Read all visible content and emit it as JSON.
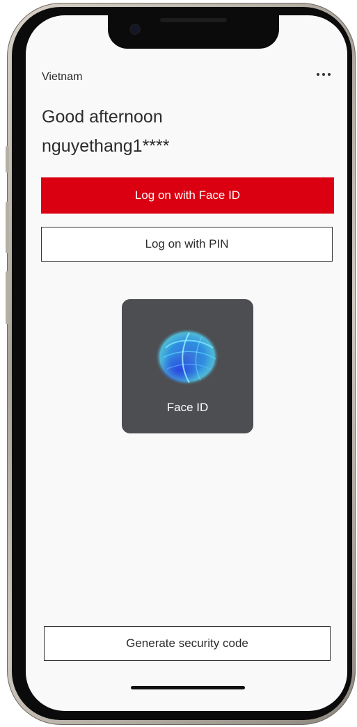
{
  "status_bar": {
    "time": "",
    "indicators": ""
  },
  "header": {
    "region": "Vietnam",
    "more_icon": "ellipsis-horizontal-icon"
  },
  "greeting": {
    "line": "Good afternoon",
    "username": "nguyethang1****"
  },
  "actions": {
    "face_id_button": "Log on with Face ID",
    "pin_button": "Log on with PIN"
  },
  "face_id_prompt": {
    "label": "Face ID",
    "icon": "face-id-scan-icon"
  },
  "footer": {
    "security_code_button": "Generate security code"
  },
  "colors": {
    "accent": "#db0011",
    "panel": "#4d4e52",
    "background": "#f9f9f9"
  }
}
